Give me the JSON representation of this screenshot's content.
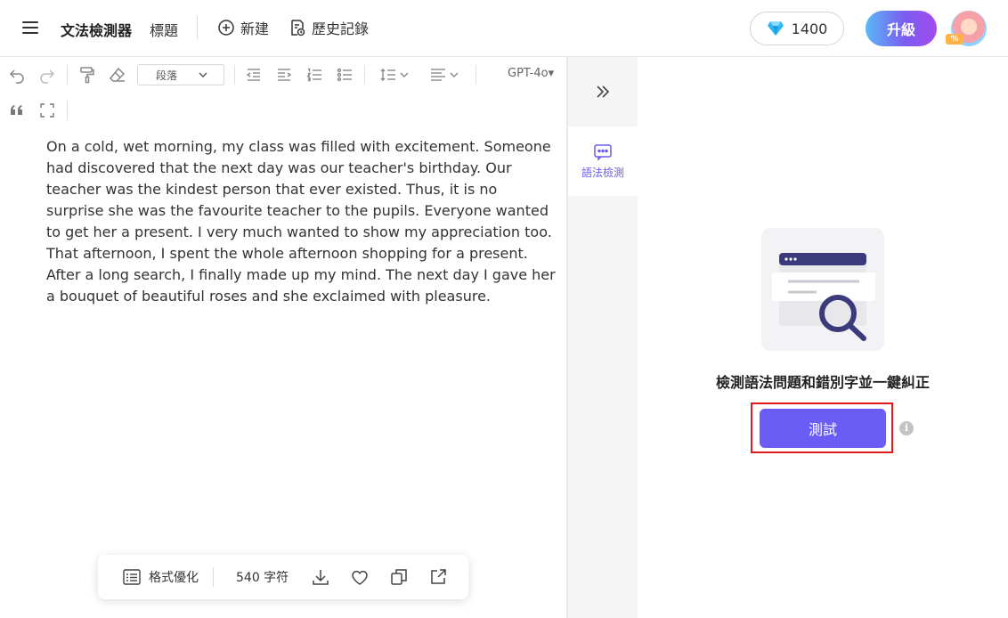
{
  "header": {
    "app_title": "文法檢測器",
    "doc_title": "標題",
    "new_label": "新建",
    "history_label": "歷史記錄",
    "credits": "1400",
    "upgrade_label": "升級",
    "avatar_badge": "%"
  },
  "toolbar": {
    "paragraph_select": "段落",
    "model": "GPT-4o▾"
  },
  "editor": {
    "text": "On a cold, wet morning, my class was filled with excitement. Someone had discovered that the next day was our teacher's birthday. Our teacher was the kindest person that ever existed. Thus, it is no surprise she was the favourite teacher to the pupils. Everyone wanted to get her a present. I very much wanted to show my appreciation too. That afternoon, I spent the whole afternoon shopping for a present. After a long search, I finally made up my mind. The next day I gave her a bouquet of beautiful roses and she exclaimed with pleasure."
  },
  "bottom_bar": {
    "format_label": "格式優化",
    "char_count": "540 字符"
  },
  "side_rail": {
    "tab_label": "語法檢測"
  },
  "panel": {
    "caption": "檢測語法問題和錯別字並一鍵糾正",
    "test_button": "測試",
    "info_glyph": "i"
  },
  "colors": {
    "accent": "#6b5cf6",
    "highlight_outline": "#e0191b",
    "illustration_navy": "#3b3a7a"
  }
}
